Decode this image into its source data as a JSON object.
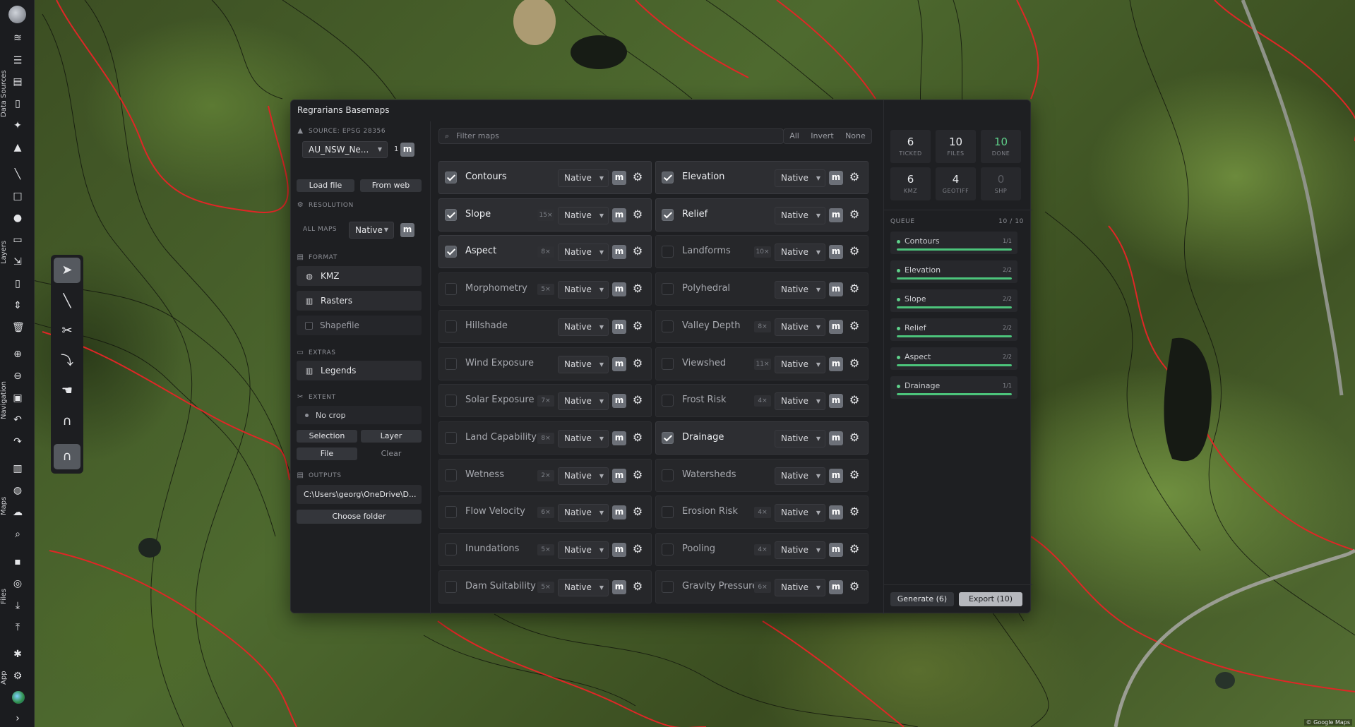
{
  "rail": {
    "sections": [
      "Data Sources",
      "Layers",
      "Navigation",
      "Maps",
      "Files",
      "App"
    ]
  },
  "attribution": "© Google Maps",
  "dialog": {
    "title": "Regrarians Basemaps",
    "source": {
      "heading": "SOURCE: EPSG 28356",
      "select_value": "AU_NSW_Ne...",
      "count": "1",
      "m_label": "m",
      "load_file": "Load file",
      "from_web": "From web"
    },
    "resolution": {
      "heading": "RESOLUTION",
      "all_maps_label": "ALL MAPS",
      "select_value": "Native",
      "m_label": "m"
    },
    "format": {
      "heading": "FORMAT",
      "options": [
        {
          "label": "KMZ",
          "icon": "globe-icon",
          "active": true
        },
        {
          "label": "Rasters",
          "icon": "book-icon",
          "active": true
        },
        {
          "label": "Shapefile",
          "icon": "checkbox",
          "active": false
        }
      ]
    },
    "extras": {
      "heading": "EXTRAS",
      "legends": "Legends"
    },
    "extent": {
      "heading": "EXTENT",
      "status": "No crop",
      "selection": "Selection",
      "layer": "Layer",
      "file": "File",
      "clear": "Clear"
    },
    "outputs": {
      "heading": "OUTPUTS",
      "path": "C:\\Users\\georg\\OneDrive\\D...",
      "choose_folder": "Choose folder"
    },
    "filter": {
      "placeholder": "Filter maps",
      "all": "All",
      "invert": "Invert",
      "none": "None"
    },
    "dropdown_value": "Native",
    "m_label": "m",
    "maps": [
      {
        "name": "Contours",
        "checked": true,
        "count": ""
      },
      {
        "name": "Elevation",
        "checked": true,
        "count": ""
      },
      {
        "name": "Slope",
        "checked": true,
        "count": "15×"
      },
      {
        "name": "Relief",
        "checked": true,
        "count": ""
      },
      {
        "name": "Aspect",
        "checked": true,
        "count": "8×"
      },
      {
        "name": "Landforms",
        "checked": false,
        "count": "10×"
      },
      {
        "name": "Morphometry",
        "checked": false,
        "count": "5×"
      },
      {
        "name": "Polyhedral",
        "checked": false,
        "count": ""
      },
      {
        "name": "Hillshade",
        "checked": false,
        "count": ""
      },
      {
        "name": "Valley Depth",
        "checked": false,
        "count": "8×"
      },
      {
        "name": "Wind Exposure",
        "checked": false,
        "count": ""
      },
      {
        "name": "Viewshed",
        "checked": false,
        "count": "11×"
      },
      {
        "name": "Solar Exposure",
        "checked": false,
        "count": "7×"
      },
      {
        "name": "Frost Risk",
        "checked": false,
        "count": "4×"
      },
      {
        "name": "Land Capability",
        "checked": false,
        "count": "8×"
      },
      {
        "name": "Drainage",
        "checked": true,
        "count": ""
      },
      {
        "name": "Wetness",
        "checked": false,
        "count": "2×"
      },
      {
        "name": "Watersheds",
        "checked": false,
        "count": ""
      },
      {
        "name": "Flow Velocity",
        "checked": false,
        "count": "6×"
      },
      {
        "name": "Erosion Risk",
        "checked": false,
        "count": "4×"
      },
      {
        "name": "Inundations",
        "checked": false,
        "count": "5×"
      },
      {
        "name": "Pooling",
        "checked": false,
        "count": "4×"
      },
      {
        "name": "Dam Suitability",
        "checked": false,
        "count": "5×"
      },
      {
        "name": "Gravity Pressure",
        "checked": false,
        "count": "6×"
      }
    ],
    "stats": [
      {
        "value": "6",
        "label": "TICKED",
        "style": "normal"
      },
      {
        "value": "10",
        "label": "FILES",
        "style": "normal"
      },
      {
        "value": "10",
        "label": "DONE",
        "style": "done"
      },
      {
        "value": "6",
        "label": "KMZ",
        "style": "normal"
      },
      {
        "value": "4",
        "label": "GEOTIFF",
        "style": "normal"
      },
      {
        "value": "0",
        "label": "SHP",
        "style": "zero"
      }
    ],
    "queue": {
      "heading": "QUEUE",
      "count": "10 / 10",
      "items": [
        {
          "name": "Contours",
          "count": "1/1",
          "progress": 1.0
        },
        {
          "name": "Elevation",
          "count": "2/2",
          "progress": 1.0
        },
        {
          "name": "Slope",
          "count": "2/2",
          "progress": 1.0
        },
        {
          "name": "Relief",
          "count": "2/2",
          "progress": 1.0
        },
        {
          "name": "Aspect",
          "count": "2/2",
          "progress": 1.0
        },
        {
          "name": "Drainage",
          "count": "1/1",
          "progress": 1.0
        }
      ]
    },
    "generate": "Generate (6)",
    "export": "Export (10)"
  },
  "colors": {
    "accent_green": "#4cc47b",
    "contour_red": "#e02626",
    "panel_bg": "#1e1f22"
  }
}
